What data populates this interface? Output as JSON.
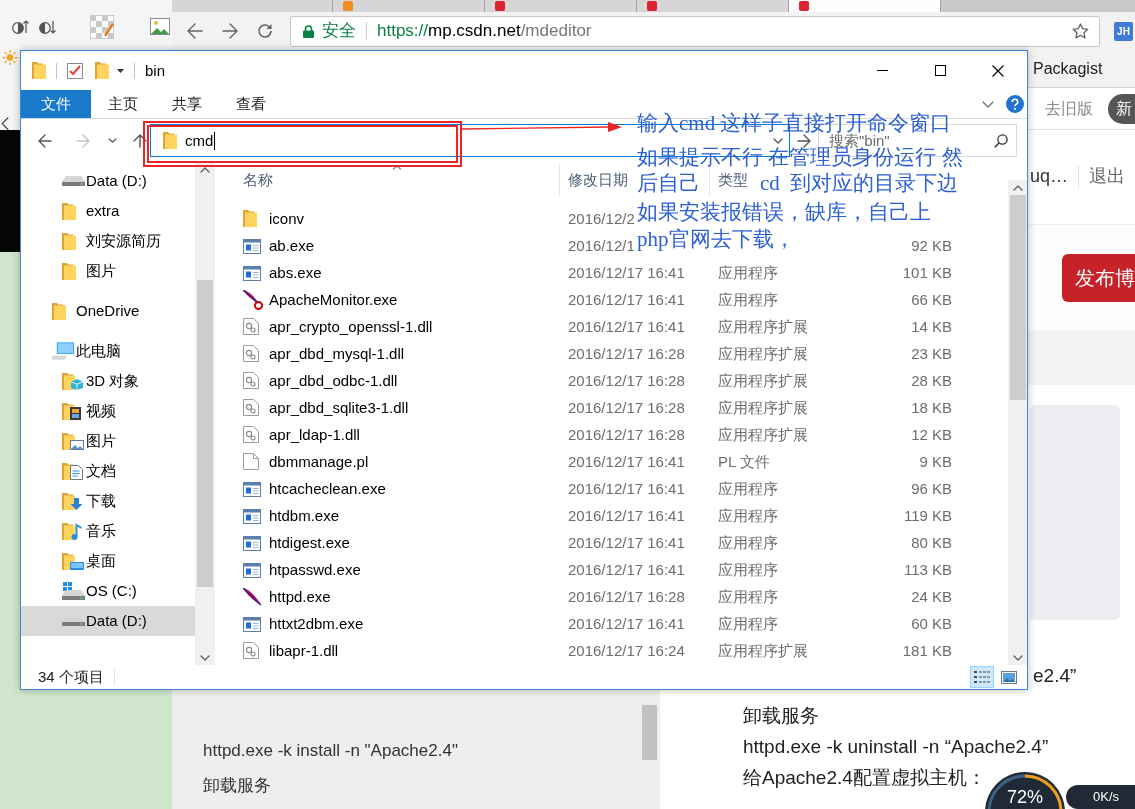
{
  "browser": {
    "tabs": [
      {
        "selected": false
      },
      {
        "selected": false,
        "color": "#f08a24"
      },
      {
        "selected": false,
        "color": "#d9232e"
      },
      {
        "selected": false,
        "color": "#d9232e"
      },
      {
        "selected": true,
        "color": "#d9232e"
      }
    ],
    "address": {
      "secure_label": "安全",
      "scheme": "https://",
      "host": "mp.csdn.net",
      "path": "/mdeditor"
    },
    "extension": "JH",
    "bookmarks": [
      "Packagist"
    ],
    "page": {
      "old_version_link": "去旧版",
      "pill_button": "新",
      "user_name": "uq…",
      "logout_link": "退出",
      "publish_button": "发布博",
      "partial_preview_line": "e2.4”",
      "source_lines": [
        "httpd.exe -k install -n \"Apache2.4\"",
        "卸载服务"
      ],
      "preview_lines": [
        "卸载服务",
        "httpd.exe -k uninstall -n “Apache2.4”",
        "给Apache2.4配置虚拟主机："
      ]
    }
  },
  "explorer": {
    "title": "bin",
    "ribbon_tabs": [
      {
        "label": "文件",
        "selected": true
      },
      {
        "label": "主页",
        "selected": false
      },
      {
        "label": "共享",
        "selected": false
      },
      {
        "label": "查看",
        "selected": false
      }
    ],
    "nav_buttons": [
      {
        "kind": "back",
        "disabled": false
      },
      {
        "kind": "forward",
        "disabled": true
      },
      {
        "kind": "recent",
        "disabled": false
      },
      {
        "kind": "up",
        "disabled": false
      }
    ],
    "address": {
      "value": "cmd"
    },
    "search": {
      "placeholder": "搜索\"bin\""
    },
    "nav_pane": {
      "items": [
        {
          "children": [
            {
              "label": "Data (D:)",
              "kind": "drive",
              "selected": false
            },
            {
              "label": "extra",
              "kind": "folder",
              "selected": false
            },
            {
              "label": "刘安源简历",
              "kind": "folder",
              "selected": false
            },
            {
              "label": "图片",
              "kind": "folder",
              "selected": false
            }
          ]
        },
        {
          "label": "OneDrive",
          "kind": "folder",
          "selected": false
        },
        {
          "label": "此电脑",
          "kind": "computer",
          "selected": false,
          "children": [
            {
              "label": "3D 对象",
              "kind": "objects",
              "selected": false
            },
            {
              "label": "视频",
              "kind": "videos",
              "selected": false
            },
            {
              "label": "图片",
              "kind": "pictures",
              "selected": false
            },
            {
              "label": "文档",
              "kind": "documents",
              "selected": false
            },
            {
              "label": "下载",
              "kind": "downloads",
              "selected": false
            },
            {
              "label": "音乐",
              "kind": "music",
              "selected": false
            },
            {
              "label": "桌面",
              "kind": "desktop",
              "selected": false
            },
            {
              "label": "OS (C:)",
              "kind": "system",
              "selected": false
            },
            {
              "label": "Data (D:)",
              "kind": "drive",
              "selected": true
            }
          ]
        }
      ]
    },
    "columns": [
      {
        "label": "名称",
        "sorted": true
      },
      {
        "label": "修改日期",
        "sorted": false
      },
      {
        "label": "类型",
        "sorted": false
      }
    ],
    "files": [
      {
        "name": "iconv",
        "kind": "folder",
        "date": "2016/12/2"
      },
      {
        "name": "ab.exe",
        "kind": "exe",
        "date": "2016/12/1",
        "size": "92 KB"
      },
      {
        "name": "abs.exe",
        "kind": "exe",
        "date": "2016/12/17 16:41",
        "type": "应用程序",
        "size": "101 KB"
      },
      {
        "name": "ApacheMonitor.exe",
        "kind": "monitor",
        "date": "2016/12/17 16:41",
        "type": "应用程序",
        "size": "66 KB"
      },
      {
        "name": "apr_crypto_openssl-1.dll",
        "kind": "dll",
        "date": "2016/12/17 16:41",
        "type": "应用程序扩展",
        "size": "14 KB"
      },
      {
        "name": "apr_dbd_mysql-1.dll",
        "kind": "dll",
        "date": "2016/12/17 16:28",
        "type": "应用程序扩展",
        "size": "23 KB"
      },
      {
        "name": "apr_dbd_odbc-1.dll",
        "kind": "dll",
        "date": "2016/12/17 16:28",
        "type": "应用程序扩展",
        "size": "28 KB"
      },
      {
        "name": "apr_dbd_sqlite3-1.dll",
        "kind": "dll",
        "date": "2016/12/17 16:28",
        "type": "应用程序扩展",
        "size": "18 KB"
      },
      {
        "name": "apr_ldap-1.dll",
        "kind": "dll",
        "date": "2016/12/17 16:28",
        "type": "应用程序扩展",
        "size": "12 KB"
      },
      {
        "name": "dbmmanage.pl",
        "kind": "file",
        "date": "2016/12/17 16:41",
        "type": "PL 文件",
        "size": "9 KB"
      },
      {
        "name": "htcacheclean.exe",
        "kind": "exe",
        "date": "2016/12/17 16:41",
        "type": "应用程序",
        "size": "96 KB"
      },
      {
        "name": "htdbm.exe",
        "kind": "exe",
        "date": "2016/12/17 16:41",
        "type": "应用程序",
        "size": "119 KB"
      },
      {
        "name": "htdigest.exe",
        "kind": "exe",
        "date": "2016/12/17 16:41",
        "type": "应用程序",
        "size": "80 KB"
      },
      {
        "name": "htpasswd.exe",
        "kind": "exe",
        "date": "2016/12/17 16:41",
        "type": "应用程序",
        "size": "113 KB"
      },
      {
        "name": "httpd.exe",
        "kind": "feather",
        "date": "2016/12/17 16:28",
        "type": "应用程序",
        "size": "24 KB"
      },
      {
        "name": "httxt2dbm.exe",
        "kind": "exe",
        "date": "2016/12/17 16:41",
        "type": "应用程序",
        "size": "60 KB"
      },
      {
        "name": "libapr-1.dll",
        "kind": "dll",
        "date": "2016/12/17 16:24",
        "type": "应用程序扩展",
        "size": "181 KB"
      }
    ],
    "status": "34 个项目",
    "view_modes": [
      {
        "kind": "details",
        "selected": true
      },
      {
        "kind": "tiles",
        "selected": false
      }
    ]
  },
  "annotation": {
    "lines": [
      [
        "输入cmd 这样子直接打开命令窗口"
      ],
      [
        "如果提示不行 在管理员身份运行 然"
      ],
      [
        "后自己",
        "cd",
        "到对应的目录下边"
      ],
      [
        "如果安装报错误，缺库，自己上"
      ],
      [
        "php官网去下载，"
      ]
    ]
  },
  "widget": {
    "percent": "72%",
    "rate": "0K/s"
  }
}
